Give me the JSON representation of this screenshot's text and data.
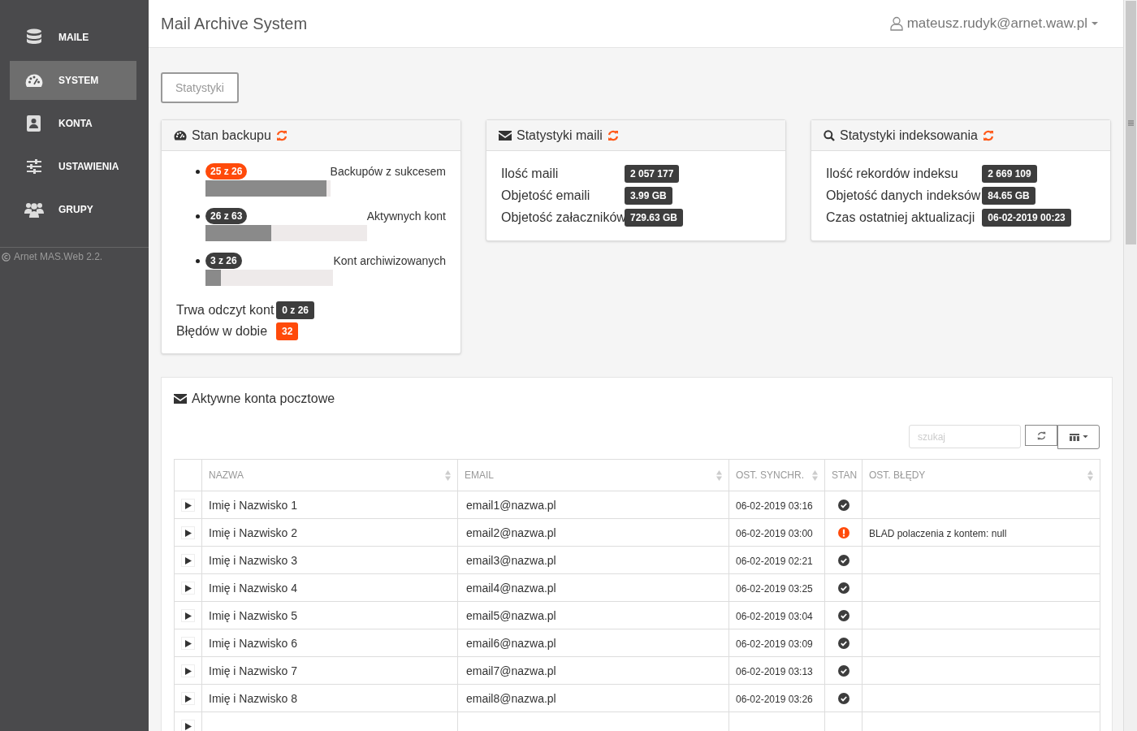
{
  "sidebar": {
    "items": [
      {
        "label": "MAILE",
        "selected": false
      },
      {
        "label": "SYSTEM",
        "selected": true
      },
      {
        "label": "KONTA",
        "selected": false
      },
      {
        "label": "USTAWIENIA",
        "selected": false
      },
      {
        "label": "GRUPY",
        "selected": false
      }
    ],
    "footer": "Arnet MAS.Web 2.2."
  },
  "header": {
    "title": "Mail Archive System",
    "user": "mateusz.rudyk@arnet.waw.pl"
  },
  "tabs": [
    {
      "label": "Statystyki",
      "selected": true
    }
  ],
  "backup_panel": {
    "title": "Stan backupu",
    "items": [
      {
        "badge": "25 z 26",
        "color": "#ff4a0a",
        "level": 0.97,
        "label": "Backupów z sukcesem"
      },
      {
        "badge": "26 z 63",
        "color": "#3d3d3d",
        "level": 0.41,
        "label": "Aktywnych kont"
      },
      {
        "badge": "3 z 26",
        "color": "#3d3d3d",
        "level": 0.12,
        "label": "Kont archiwizowanych"
      }
    ],
    "summary": [
      {
        "label": "Trwa odczyt kont",
        "value": "0 z 26",
        "color": "#3d3d3d"
      },
      {
        "label": "Błędów w dobie",
        "value": "32",
        "color": "#ff4a0a"
      }
    ]
  },
  "stat_panels": [
    {
      "title": "Statystyki maili",
      "rows": [
        {
          "label": "Ilość maili",
          "value": "2 057 177"
        },
        {
          "label": "Objetość emaili",
          "value": "3.99 GB"
        },
        {
          "label": "Objetość załaczników",
          "value": "729.63 GB"
        }
      ]
    },
    {
      "title": "Statystyki indeksowania",
      "rows": [
        {
          "label": "Ilość rekordów indeksu",
          "value": "2 669 109"
        },
        {
          "label": "Objetość danych indeksów",
          "value": "84.65 GB"
        },
        {
          "label": "Czas ostatniej aktualizacji",
          "value": "06-02-2019 00:23"
        }
      ]
    }
  ],
  "accounts": {
    "title": "Aktywne konta pocztowe",
    "search": {
      "placeholder": "szukaj"
    },
    "columns": [
      {
        "label": "NAZWA",
        "sortable": true
      },
      {
        "label": "EMAIL",
        "sortable": true
      },
      {
        "label": "OST. SYNCHR.",
        "sortable": true
      },
      {
        "label": "STAN",
        "sortable": false
      },
      {
        "label": "OST. BŁĘDY",
        "sortable": true
      }
    ],
    "rows": [
      {
        "name": "Imię i Nazwisko 1",
        "email": "email1@nazwa.pl",
        "sync": "06-02-2019 03:16",
        "kind": "ok"
      },
      {
        "name": "Imię i Nazwisko 2",
        "email": "email2@nazwa.pl",
        "sync": "06-02-2019 03:00",
        "kind": "error",
        "error": "BLAD polaczenia z kontem: null"
      },
      {
        "name": "Imię i Nazwisko 3",
        "email": "email3@nazwa.pl",
        "sync": "06-02-2019 02:21",
        "kind": "ok"
      },
      {
        "name": "Imię i Nazwisko 4",
        "email": "email4@nazwa.pl",
        "sync": "06-02-2019 03:25",
        "kind": "ok"
      },
      {
        "name": "Imię i Nazwisko 5",
        "email": "email5@nazwa.pl",
        "sync": "06-02-2019 03:04",
        "kind": "ok"
      },
      {
        "name": "Imię i Nazwisko 6",
        "email": "email6@nazwa.pl",
        "sync": "06-02-2019 03:09",
        "kind": "ok"
      },
      {
        "name": "Imię i Nazwisko 7",
        "email": "email7@nazwa.pl",
        "sync": "06-02-2019 03:13",
        "kind": "ok"
      },
      {
        "name": "Imię i Nazwisko 8",
        "email": "email8@nazwa.pl",
        "sync": "06-02-2019 03:26",
        "kind": "ok"
      },
      {
        "kind": "blank"
      }
    ]
  }
}
